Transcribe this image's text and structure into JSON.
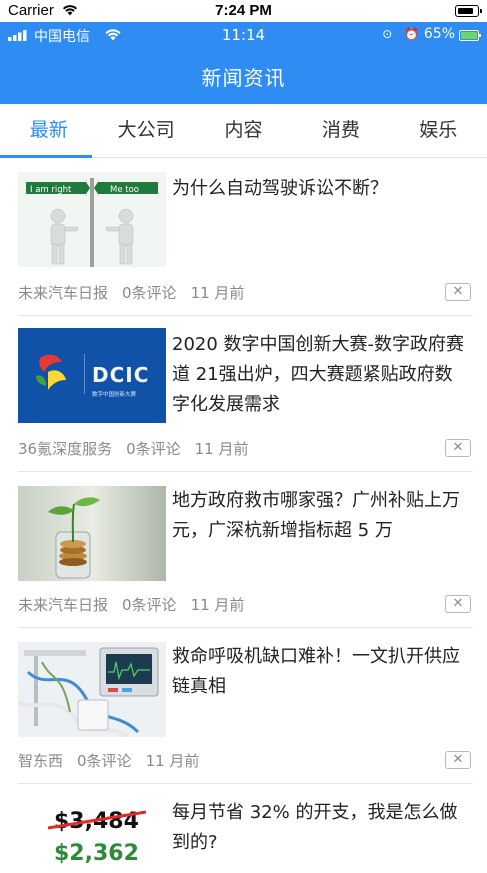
{
  "sim_status": {
    "carrier": "Carrier",
    "time": "7:24 PM"
  },
  "app_status": {
    "carrier": "中国电信",
    "time": "11:14",
    "indicators": "⊙ ⏰",
    "battery_pct": "65%"
  },
  "header": {
    "title": "新闻资讯"
  },
  "tabs": [
    {
      "label": "最新",
      "active": true
    },
    {
      "label": "大公司",
      "active": false
    },
    {
      "label": "内容",
      "active": false
    },
    {
      "label": "消费",
      "active": false
    },
    {
      "label": "娱乐",
      "active": false
    }
  ],
  "news": [
    {
      "thumb": "i-am-right-me-too-signs",
      "thumb_text": [
        "I am right",
        "Me too"
      ],
      "title": "为什么自动驾驶诉讼不断？",
      "source": "未来汽车日报",
      "comments": "0条评论",
      "time": "11 月前"
    },
    {
      "thumb": "digital-china-logo",
      "thumb_text": [
        "DCIC",
        "数字中国创新大赛"
      ],
      "title": "2020 数字中国创新大赛-数字政府赛道 21强出炉，四大赛题紧贴政府数字化发展需求",
      "source": "36氪深度服务",
      "comments": "0条评论",
      "time": "11 月前"
    },
    {
      "thumb": "coins-with-plant",
      "title": "地方政府救市哪家强？广州补贴上万元，广深杭新增指标超 5 万",
      "source": "未来汽车日报",
      "comments": "0条评论",
      "time": "11 月前"
    },
    {
      "thumb": "ventilator-equipment",
      "title": "救命呼吸机缺口难补！一文扒开供应链真相",
      "source": "智东西",
      "comments": "0条评论",
      "time": "11 月前"
    },
    {
      "thumb": "price-strikethrough",
      "thumb_text": [
        "$3,484",
        "$2,362"
      ],
      "title": "每月节省 32% 的开支，我是怎么做到的?"
    }
  ],
  "close_label": "✕",
  "colors": {
    "accent": "#2f8cf2",
    "meta": "#8a8a8a",
    "price_old": "#111111",
    "price_new": "#2e8b3a",
    "strike": "#e02b2b"
  }
}
